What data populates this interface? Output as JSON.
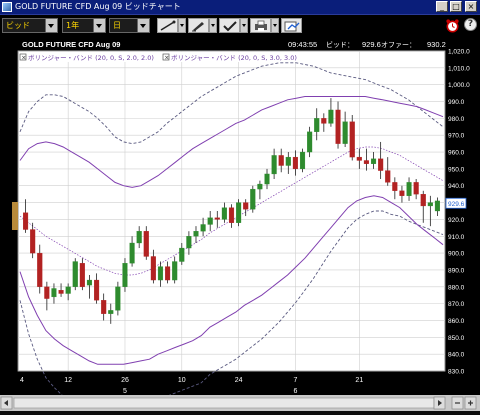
{
  "window": {
    "title": "GOLD FUTURE CFD Aug 09 ビッドチャート",
    "minimize_glyph": "_",
    "maximize_glyph": "□",
    "close_glyph": "×"
  },
  "toolbar": {
    "price_type": "ビッド",
    "period": "1年",
    "interval": "日",
    "tools": [
      "draw-line-icon",
      "pencil-icon",
      "checkmark-icon",
      "print-icon",
      "export-icon"
    ],
    "alarm_icon": "alarm-clock-icon",
    "help_label": "?"
  },
  "chart_header": {
    "symbol": "GOLD FUTURE CFD Aug 09",
    "time": "09:43:55",
    "bid_label": "ビッド：",
    "bid": "929.6",
    "offer_label": "オファー：",
    "offer": "930.2",
    "indicators": [
      "ボリンジャー・バンド (20, 0, S, 2.0, 2.0)",
      "ボリンジャー・バンド (20, 0, S, 3.0, 3.0)"
    ],
    "close_glyph": "×"
  },
  "colors": {
    "background": "#000000",
    "plot_bg": "#ffffff",
    "grid": "#cfcfcf",
    "up": "#2e8b2e",
    "down": "#b22222",
    "band_2sd": "#8040b0",
    "band_3sd": "#5a5a80",
    "current_price": "#1f5fd0"
  },
  "chart_data": {
    "type": "candlestick",
    "y_axis": {
      "min": 830,
      "max": 1020,
      "step": 10,
      "position": "right"
    },
    "y_ticks": [
      "1,020.0",
      "1,010.0",
      "1,000.0",
      "990.0",
      "980.0",
      "970.0",
      "960.0",
      "950.0",
      "940.0",
      "930.0",
      "920.0",
      "910.0",
      "900.0",
      "890.0",
      "880.0",
      "870.0",
      "860.0",
      "850.0",
      "840.0",
      "830.0"
    ],
    "x_ticks": [
      {
        "day": "4",
        "month": ""
      },
      {
        "day": "12",
        "month": ""
      },
      {
        "day": "26",
        "month": "5"
      },
      {
        "day": "10",
        "month": ""
      },
      {
        "day": "24",
        "month": ""
      },
      {
        "day": "7",
        "month": "6"
      },
      {
        "day": "21",
        "month": ""
      }
    ],
    "current_price": 929.6,
    "candles": [
      {
        "o": 924,
        "h": 932,
        "l": 912,
        "c": 914
      },
      {
        "o": 914,
        "h": 918,
        "l": 897,
        "c": 900
      },
      {
        "o": 900,
        "h": 905,
        "l": 876,
        "c": 880
      },
      {
        "o": 880,
        "h": 883,
        "l": 866,
        "c": 873
      },
      {
        "o": 874,
        "h": 882,
        "l": 870,
        "c": 879
      },
      {
        "o": 878,
        "h": 882,
        "l": 874,
        "c": 876
      },
      {
        "o": 876,
        "h": 882,
        "l": 872,
        "c": 880
      },
      {
        "o": 880,
        "h": 897,
        "l": 878,
        "c": 895
      },
      {
        "o": 894,
        "h": 897,
        "l": 878,
        "c": 880
      },
      {
        "o": 881,
        "h": 887,
        "l": 873,
        "c": 884
      },
      {
        "o": 884,
        "h": 888,
        "l": 870,
        "c": 872
      },
      {
        "o": 872,
        "h": 876,
        "l": 860,
        "c": 864
      },
      {
        "o": 864,
        "h": 870,
        "l": 858,
        "c": 866
      },
      {
        "o": 866,
        "h": 883,
        "l": 863,
        "c": 880
      },
      {
        "o": 880,
        "h": 897,
        "l": 877,
        "c": 894
      },
      {
        "o": 894,
        "h": 910,
        "l": 892,
        "c": 906
      },
      {
        "o": 906,
        "h": 916,
        "l": 903,
        "c": 913
      },
      {
        "o": 913,
        "h": 916,
        "l": 896,
        "c": 898
      },
      {
        "o": 898,
        "h": 902,
        "l": 882,
        "c": 884
      },
      {
        "o": 884,
        "h": 895,
        "l": 880,
        "c": 892
      },
      {
        "o": 892,
        "h": 895,
        "l": 882,
        "c": 884
      },
      {
        "o": 884,
        "h": 898,
        "l": 882,
        "c": 895
      },
      {
        "o": 895,
        "h": 906,
        "l": 893,
        "c": 903
      },
      {
        "o": 903,
        "h": 913,
        "l": 899,
        "c": 910
      },
      {
        "o": 910,
        "h": 916,
        "l": 906,
        "c": 913
      },
      {
        "o": 913,
        "h": 921,
        "l": 910,
        "c": 917
      },
      {
        "o": 917,
        "h": 925,
        "l": 913,
        "c": 921
      },
      {
        "o": 921,
        "h": 925,
        "l": 915,
        "c": 920
      },
      {
        "o": 920,
        "h": 930,
        "l": 918,
        "c": 927
      },
      {
        "o": 927,
        "h": 929,
        "l": 915,
        "c": 918
      },
      {
        "o": 918,
        "h": 932,
        "l": 916,
        "c": 930
      },
      {
        "o": 930,
        "h": 932,
        "l": 922,
        "c": 926
      },
      {
        "o": 926,
        "h": 940,
        "l": 924,
        "c": 938
      },
      {
        "o": 938,
        "h": 943,
        "l": 932,
        "c": 941
      },
      {
        "o": 941,
        "h": 950,
        "l": 938,
        "c": 947
      },
      {
        "o": 947,
        "h": 962,
        "l": 944,
        "c": 958
      },
      {
        "o": 958,
        "h": 962,
        "l": 948,
        "c": 952
      },
      {
        "o": 952,
        "h": 960,
        "l": 947,
        "c": 957
      },
      {
        "o": 957,
        "h": 961,
        "l": 946,
        "c": 950
      },
      {
        "o": 950,
        "h": 962,
        "l": 948,
        "c": 960
      },
      {
        "o": 960,
        "h": 975,
        "l": 957,
        "c": 972
      },
      {
        "o": 972,
        "h": 986,
        "l": 967,
        "c": 980
      },
      {
        "o": 980,
        "h": 983,
        "l": 972,
        "c": 977
      },
      {
        "o": 977,
        "h": 992,
        "l": 975,
        "c": 985
      },
      {
        "o": 985,
        "h": 990,
        "l": 962,
        "c": 965
      },
      {
        "o": 965,
        "h": 984,
        "l": 963,
        "c": 978
      },
      {
        "o": 978,
        "h": 982,
        "l": 955,
        "c": 957
      },
      {
        "o": 957,
        "h": 962,
        "l": 950,
        "c": 955
      },
      {
        "o": 955,
        "h": 962,
        "l": 949,
        "c": 953
      },
      {
        "o": 953,
        "h": 960,
        "l": 950,
        "c": 956
      },
      {
        "o": 956,
        "h": 966,
        "l": 944,
        "c": 949
      },
      {
        "o": 949,
        "h": 957,
        "l": 940,
        "c": 942
      },
      {
        "o": 942,
        "h": 945,
        "l": 932,
        "c": 937
      },
      {
        "o": 937,
        "h": 940,
        "l": 930,
        "c": 934
      },
      {
        "o": 934,
        "h": 945,
        "l": 931,
        "c": 942
      },
      {
        "o": 942,
        "h": 944,
        "l": 932,
        "c": 935
      },
      {
        "o": 935,
        "h": 937,
        "l": 918,
        "c": 928
      },
      {
        "o": 928,
        "h": 934,
        "l": 916,
        "c": 930
      },
      {
        "o": 925,
        "h": 933,
        "l": 922,
        "c": 931
      }
    ],
    "band_2sd": {
      "upper": [
        955,
        962,
        965,
        966,
        965,
        963,
        960,
        957,
        954,
        950,
        946,
        942,
        940,
        939,
        940,
        943,
        946,
        950,
        954,
        958,
        962,
        965,
        968,
        971,
        974,
        977,
        979,
        982,
        985,
        987,
        989,
        991,
        992,
        993,
        993,
        993,
        993,
        993,
        993,
        993,
        993,
        992,
        991,
        990,
        989,
        988,
        987,
        985,
        983,
        981
      ],
      "middle": [
        922,
        918,
        914,
        910,
        907,
        904,
        901,
        898,
        895,
        892,
        890,
        888,
        887,
        887,
        888,
        890,
        893,
        896,
        899,
        902,
        905,
        908,
        912,
        915,
        918,
        921,
        924,
        927,
        930,
        933,
        936,
        939,
        942,
        945,
        948,
        951,
        954,
        957,
        960,
        962,
        963,
        963,
        962,
        960,
        958,
        955,
        952,
        949,
        946,
        943
      ],
      "lower": [
        889,
        874,
        863,
        854,
        849,
        845,
        842,
        839,
        836,
        834,
        834,
        834,
        834,
        835,
        836,
        837,
        840,
        842,
        844,
        846,
        848,
        851,
        856,
        859,
        862,
        865,
        869,
        872,
        875,
        879,
        883,
        887,
        892,
        897,
        903,
        909,
        915,
        921,
        927,
        931,
        933,
        934,
        933,
        930,
        927,
        922,
        917,
        913,
        909,
        905
      ]
    },
    "band_3sd": {
      "upper": [
        972,
        984,
        990,
        994,
        994,
        993,
        990,
        987,
        984,
        980,
        975,
        969,
        966,
        965,
        966,
        969,
        972,
        977,
        981,
        985,
        989,
        993,
        996,
        999,
        1002,
        1005,
        1007,
        1009,
        1011,
        1012,
        1013,
        1013,
        1013,
        1012,
        1011,
        1009,
        1007,
        1006,
        1005,
        1004,
        1003,
        1001,
        999,
        997,
        994,
        991,
        987,
        983,
        979,
        975
      ],
      "lower": [
        872,
        852,
        837,
        826,
        820,
        815,
        812,
        809,
        806,
        804,
        805,
        807,
        808,
        809,
        810,
        811,
        814,
        815,
        817,
        819,
        821,
        823,
        828,
        831,
        834,
        837,
        841,
        845,
        849,
        854,
        859,
        865,
        871,
        878,
        885,
        893,
        901,
        908,
        915,
        920,
        923,
        925,
        925,
        923,
        922,
        919,
        917,
        915,
        913,
        911
      ]
    }
  }
}
